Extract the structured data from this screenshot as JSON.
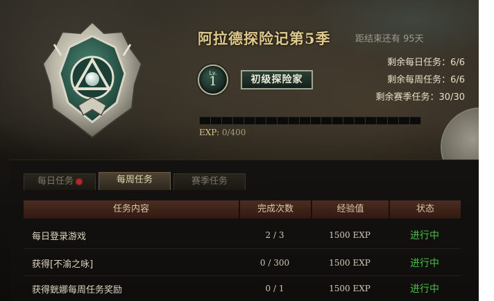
{
  "header": {
    "season_title": "阿拉德探险记第5季",
    "countdown": "距结束还有 95天",
    "level_prefix": "Lv.",
    "level": "1",
    "rank_title": "初级探险家",
    "remaining_daily": "剩余每日任务：6/6",
    "remaining_weekly": "剩余每周任务：6/6",
    "remaining_season": "剩余赛季任务：30/30",
    "exp_label": "EXP:",
    "exp_value": "0/400",
    "exp_progress": 0
  },
  "tabs": [
    {
      "label": "每日任务",
      "has_alert": true,
      "active": false
    },
    {
      "label": "每周任务",
      "has_alert": false,
      "active": true
    },
    {
      "label": "赛季任务",
      "has_alert": false,
      "active": false
    }
  ],
  "table": {
    "columns": [
      "任务内容",
      "完成次数",
      "经验值",
      "状态"
    ],
    "rows": [
      {
        "task": "每日登录游戏",
        "count": "2 / 3",
        "exp": "1500 EXP",
        "status": "进行中"
      },
      {
        "task": "获得[不渝之咏]",
        "count": "0 / 300",
        "exp": "1500 EXP",
        "status": "进行中"
      },
      {
        "task": "获得皝娜每周任务奖励",
        "count": "0 / 1",
        "exp": "1500 EXP",
        "status": "进行中"
      }
    ]
  },
  "colors": {
    "accent_gold": "#e0c98d",
    "status_green": "#4ebc4a",
    "table_header": "#4b2c20",
    "alert_red": "#c22222"
  },
  "icons": [
    "season-emblem-icon",
    "level-badge-icon",
    "alert-dot-icon"
  ]
}
